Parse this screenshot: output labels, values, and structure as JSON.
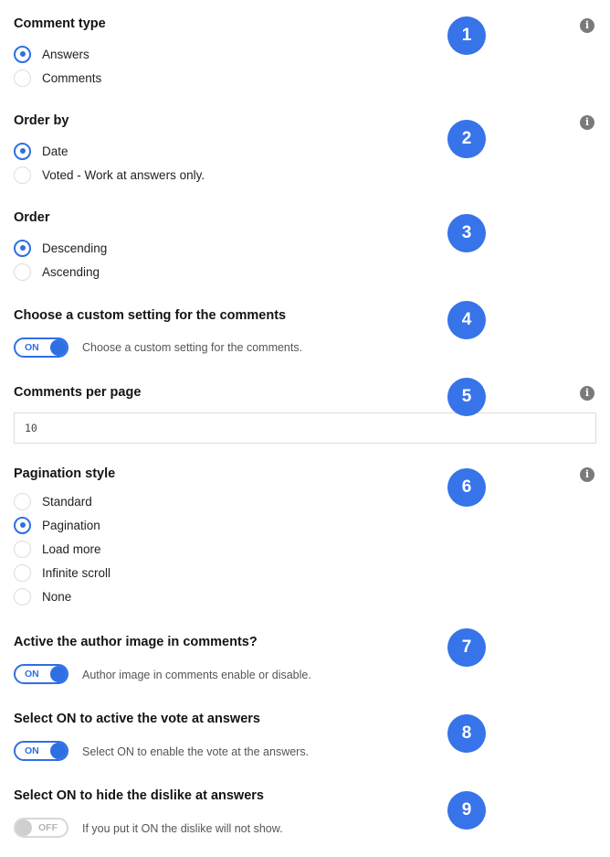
{
  "comment_type": {
    "title": "Comment type",
    "badge": "1",
    "options": [
      {
        "label": "Answers",
        "checked": true
      },
      {
        "label": "Comments",
        "checked": false
      }
    ]
  },
  "order_by": {
    "title": "Order by",
    "badge": "2",
    "options": [
      {
        "label": "Date",
        "checked": true
      },
      {
        "label": "Voted - Work at answers only.",
        "checked": false
      }
    ]
  },
  "order": {
    "title": "Order",
    "badge": "3",
    "options": [
      {
        "label": "Descending",
        "checked": true
      },
      {
        "label": "Ascending",
        "checked": false
      }
    ]
  },
  "custom_setting": {
    "title": "Choose a custom setting for the comments",
    "badge": "4",
    "toggle": "ON",
    "description": "Choose a custom setting for the comments."
  },
  "comments_per_page": {
    "title": "Comments per page",
    "badge": "5",
    "value": "10"
  },
  "pagination_style": {
    "title": "Pagination style",
    "badge": "6",
    "options": [
      {
        "label": "Standard",
        "checked": false
      },
      {
        "label": "Pagination",
        "checked": true
      },
      {
        "label": "Load more",
        "checked": false
      },
      {
        "label": "Infinite scroll",
        "checked": false
      },
      {
        "label": "None",
        "checked": false
      }
    ]
  },
  "author_image": {
    "title": "Active the author image in comments?",
    "badge": "7",
    "toggle": "ON",
    "description": "Author image in comments enable or disable."
  },
  "vote": {
    "title": "Select ON to active the vote at answers",
    "badge": "8",
    "toggle": "ON",
    "description": "Select ON to enable the vote at the answers."
  },
  "dislike": {
    "title": "Select ON to hide the dislike at answers",
    "badge": "9",
    "toggle": "OFF",
    "description": "If you put it ON the dislike will not show."
  },
  "info_icon_glyph": "i",
  "colors": {
    "accent": "#2f6fe4",
    "badge": "#3773e9",
    "info_icon": "#7a7a7a"
  }
}
